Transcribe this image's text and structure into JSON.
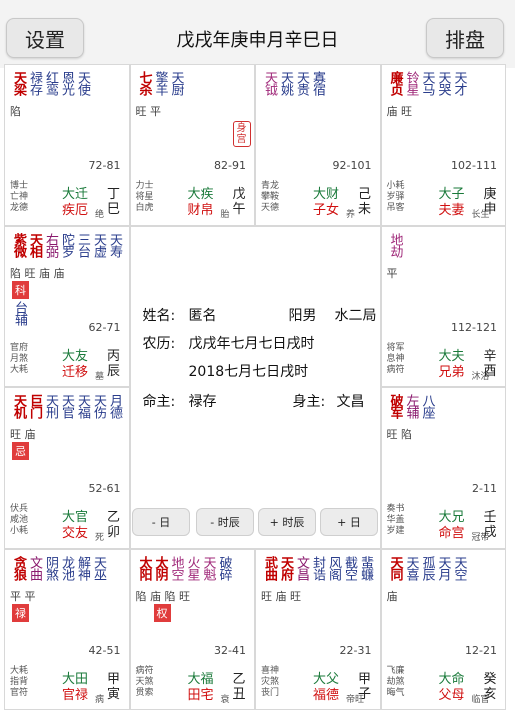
{
  "toolbar": {
    "settings_label": "设置",
    "title": "戊戌年庚申月辛巳日",
    "chart_label": "排盘"
  },
  "center": {
    "name_label": "姓名:",
    "name_value": "匿名",
    "gender": "阳男",
    "bureau": "水二局",
    "lunar_label": "农历:",
    "lunar_value": "戊戌年七月七日戌时",
    "solar_value": "2018七月七日戌时",
    "ming_label": "命主:",
    "ming_value": "禄存",
    "shen_label": "身主:",
    "shen_value": "文昌",
    "buttons": [
      "- 日",
      "- 时辰",
      "+ 时辰",
      "+ 日"
    ]
  },
  "cells": [
    {
      "stars": [
        [
          "天梁",
          "main"
        ],
        [
          "禄存",
          "minor"
        ],
        [
          "红鸾",
          "minor"
        ],
        [
          "恩光",
          "minor"
        ],
        [
          "天使",
          "minor"
        ]
      ],
      "bright": "陷",
      "range": "72-81",
      "gods": [
        "博士",
        "亡神",
        "龙德"
      ],
      "palace_a": "大迁",
      "palace_b": "疾厄",
      "life": "绝",
      "stem": "丁巳"
    },
    {
      "stars": [
        [
          "七杀",
          "main"
        ],
        [
          "擎羊",
          "minor"
        ],
        [
          "天厨",
          "minor"
        ]
      ],
      "bright": "旺 平",
      "range": "82-91",
      "gods": [
        "力士",
        "将星",
        "白虎"
      ],
      "palace_a": "大疾",
      "palace_b": "财帛",
      "life": "胎",
      "stem": "戊午",
      "tag": "身宫"
    },
    {
      "stars": [
        [
          "天钺",
          "pink"
        ],
        [
          "天姚",
          "minor"
        ],
        [
          "天贵",
          "minor"
        ],
        [
          "寡宿",
          "minor"
        ]
      ],
      "bright": "",
      "range": "92-101",
      "gods": [
        "青龙",
        "攀鞍",
        "天德"
      ],
      "palace_a": "大财",
      "palace_b": "子女",
      "life": "养",
      "stem": "己未"
    },
    {
      "stars": [
        [
          "廉贞",
          "main"
        ],
        [
          "铃星",
          "pink"
        ],
        [
          "天马",
          "minor"
        ],
        [
          "天哭",
          "minor"
        ],
        [
          "天才",
          "minor"
        ]
      ],
      "bright": "庙 旺",
      "range": "102-111",
      "gods": [
        "小耗",
        "岁驿",
        "吊客"
      ],
      "palace_a": "大子",
      "palace_b": "夫妻",
      "life": "长生",
      "stem": "庚申"
    },
    {
      "stars": [
        [
          "紫微",
          "main"
        ],
        [
          "天相",
          "main"
        ],
        [
          "右弼",
          "purple"
        ],
        [
          "陀罗",
          "minor"
        ],
        [
          "三台",
          "minor"
        ],
        [
          "天虚",
          "minor"
        ],
        [
          "天寿",
          "minor"
        ]
      ],
      "bright": "陷 旺 庙 庙",
      "hua": "科",
      "extra": "台辅",
      "range": "62-71",
      "gods": [
        "官府",
        "月煞",
        "大耗"
      ],
      "palace_a": "大友",
      "palace_b": "迁移",
      "life": "墓",
      "stem": "丙辰"
    },
    {
      "stars": [
        [
          "地劫",
          "pink"
        ]
      ],
      "bright": "平",
      "range": "112-121",
      "gods": [
        "将军",
        "息神",
        "病符"
      ],
      "palace_a": "大夫",
      "palace_b": "兄弟",
      "life": "沐浴",
      "stem": "辛酉"
    },
    {
      "stars": [
        [
          "天机",
          "main"
        ],
        [
          "巨门",
          "main"
        ],
        [
          "天刑",
          "minor"
        ],
        [
          "天官",
          "minor"
        ],
        [
          "天福",
          "minor"
        ],
        [
          "天伤",
          "minor"
        ],
        [
          "月德",
          "minor"
        ]
      ],
      "bright": "旺 庙",
      "hua": "忌",
      "range": "52-61",
      "gods": [
        "伏兵",
        "咸池",
        "小耗"
      ],
      "palace_a": "大官",
      "palace_b": "交友",
      "life": "死",
      "stem": "乙卯"
    },
    {
      "stars": [
        [
          "破军",
          "main"
        ],
        [
          "左辅",
          "purple"
        ],
        [
          "八座",
          "minor"
        ]
      ],
      "bright": "旺 陷",
      "range": "2-11",
      "gods": [
        "奏书",
        "华盖",
        "岁建"
      ],
      "palace_a": "大兄",
      "palace_b": "命宫",
      "life": "冠带",
      "stem": "壬戌"
    },
    {
      "stars": [
        [
          "贪狼",
          "main"
        ],
        [
          "文曲",
          "purple"
        ],
        [
          "阴煞",
          "minor"
        ],
        [
          "龙池",
          "minor"
        ],
        [
          "解神",
          "minor"
        ],
        [
          "天巫",
          "minor"
        ]
      ],
      "bright": "平 平",
      "hua": "禄",
      "range": "42-51",
      "gods": [
        "大耗",
        "指背",
        "官符"
      ],
      "palace_a": "大田",
      "palace_b": "官禄",
      "life": "病",
      "stem": "甲寅"
    },
    {
      "stars": [
        [
          "太阳",
          "main"
        ],
        [
          "太阴",
          "main"
        ],
        [
          "地空",
          "pink"
        ],
        [
          "火星",
          "pink"
        ],
        [
          "天魁",
          "pink"
        ],
        [
          "破碎",
          "minor"
        ]
      ],
      "bright": "陷 庙 陷 旺",
      "hua": "权",
      "range": "32-41",
      "gods": [
        "病符",
        "天煞",
        "贯索"
      ],
      "palace_a": "大福",
      "palace_b": "田宅",
      "life": "衰",
      "stem": "乙丑"
    },
    {
      "stars": [
        [
          "武曲",
          "main"
        ],
        [
          "天府",
          "main"
        ],
        [
          "文昌",
          "purple"
        ],
        [
          "封诰",
          "minor"
        ],
        [
          "风阁",
          "minor"
        ],
        [
          "截空",
          "minor"
        ],
        [
          "蜚蠊",
          "minor"
        ]
      ],
      "bright": "旺 庙 旺",
      "range": "22-31",
      "gods": [
        "喜神",
        "灾煞",
        "丧门"
      ],
      "palace_a": "大父",
      "palace_b": "福德",
      "life": "帝旺",
      "stem": "甲子"
    },
    {
      "stars": [
        [
          "天同",
          "main"
        ],
        [
          "天喜",
          "minor"
        ],
        [
          "孤辰",
          "minor"
        ],
        [
          "天月",
          "minor"
        ],
        [
          "天空",
          "minor"
        ]
      ],
      "bright": "庙",
      "range": "12-21",
      "gods": [
        "飞廉",
        "劫煞",
        "晦气"
      ],
      "palace_a": "大命",
      "palace_b": "父母",
      "life": "临官",
      "stem": "癸亥"
    }
  ]
}
